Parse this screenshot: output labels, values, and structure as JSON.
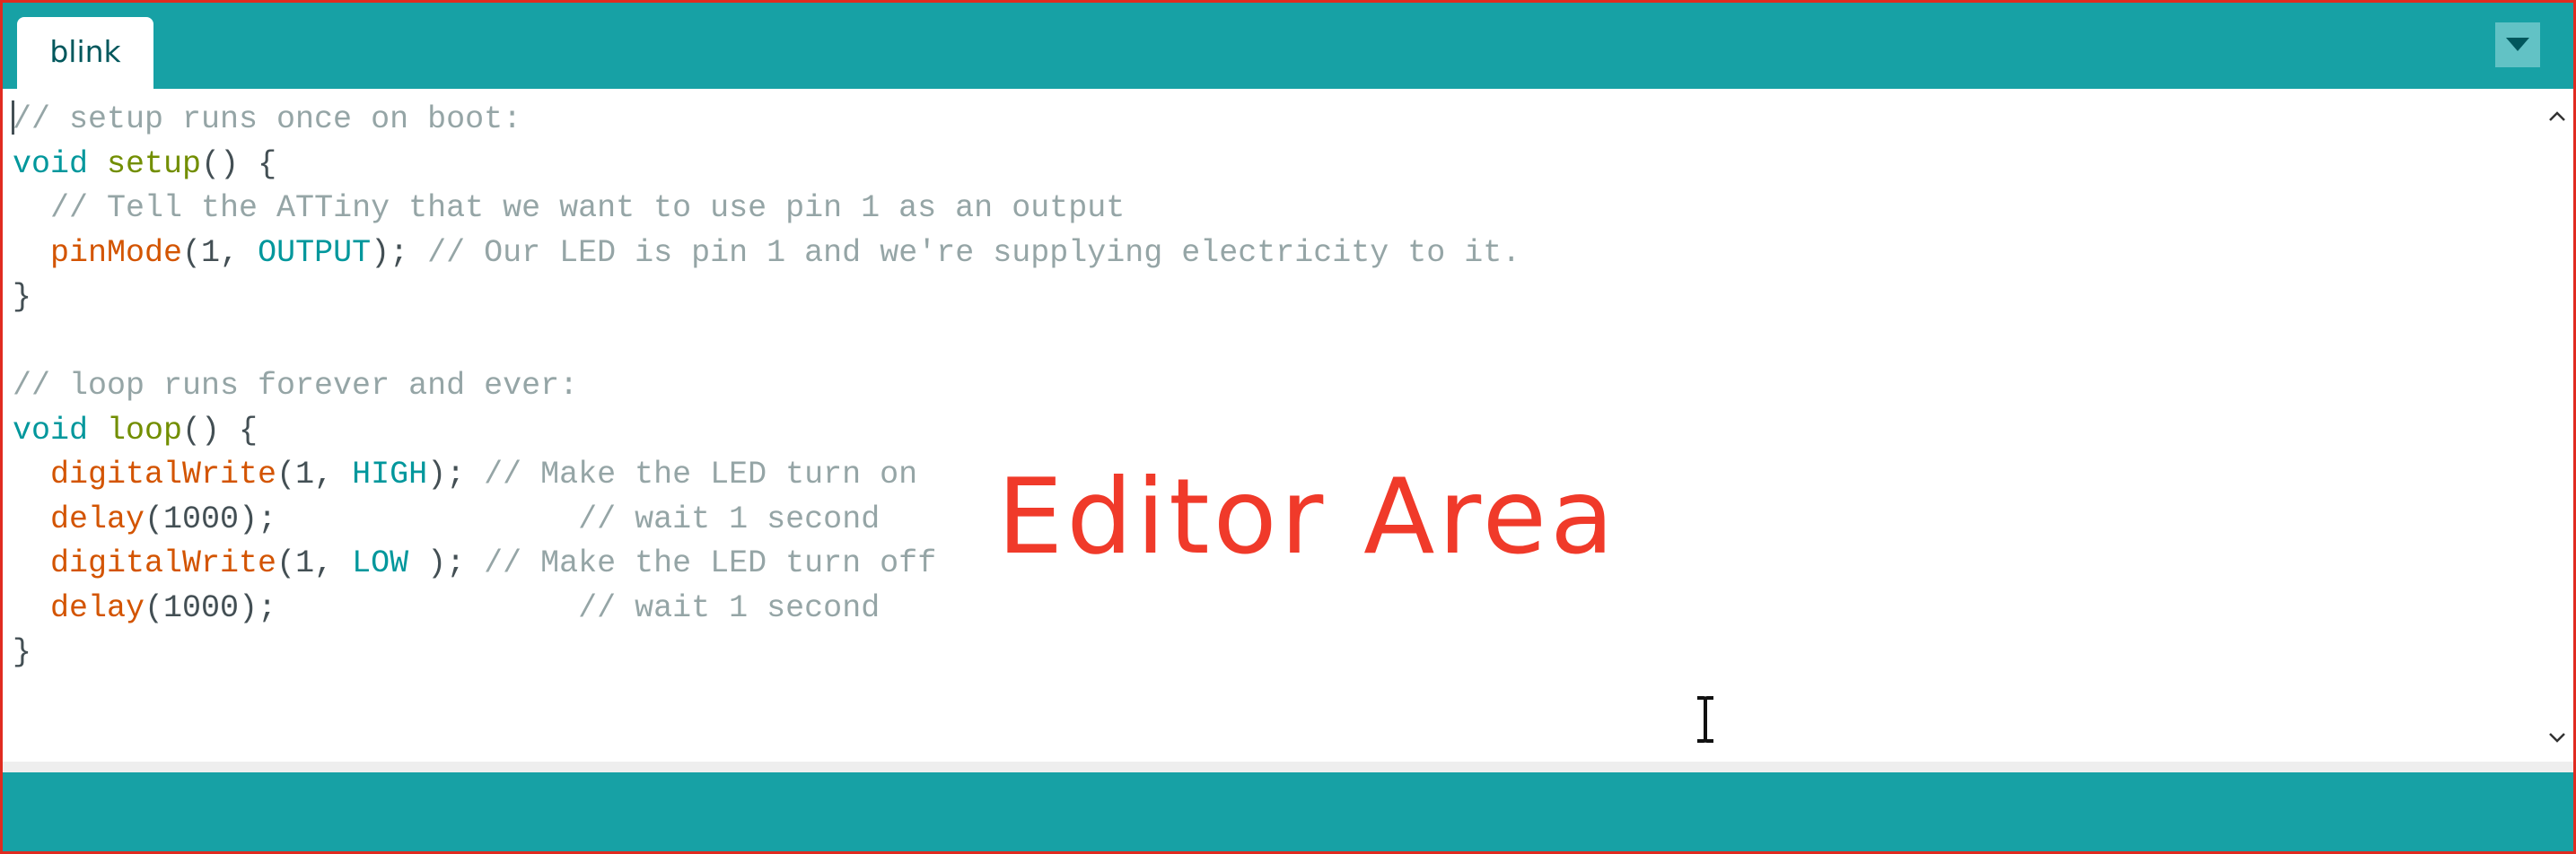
{
  "tabs": [
    {
      "label": "blink",
      "active": true
    }
  ],
  "tab_menu_icon": "triangle-down-icon",
  "overlay_label": "Editor Area",
  "colors": {
    "toolbar_teal": "#17a1a5",
    "tab_text": "#00575c",
    "comment": "#95a5a6",
    "keyword": "#00979c",
    "function": "#728e00",
    "builtin": "#d35400",
    "constant": "#00979c",
    "plain": "#434f54",
    "annotation_red": "#f03a2a"
  },
  "code_lines": [
    [
      [
        "comment",
        "// setup runs once on boot:"
      ]
    ],
    [
      [
        "keyword",
        "void"
      ],
      [
        "plain",
        " "
      ],
      [
        "function",
        "setup"
      ],
      [
        "plain",
        "() {"
      ]
    ],
    [
      [
        "plain",
        "  "
      ],
      [
        "comment",
        "// Tell the ATTiny that we want to use pin 1 as an output"
      ]
    ],
    [
      [
        "plain",
        "  "
      ],
      [
        "builtin",
        "pinMode"
      ],
      [
        "plain",
        "(1, "
      ],
      [
        "constant",
        "OUTPUT"
      ],
      [
        "plain",
        "); "
      ],
      [
        "comment",
        "// Our LED is pin 1 and we're supplying electricity to it."
      ]
    ],
    [
      [
        "plain",
        "}"
      ]
    ],
    [
      [
        "plain",
        ""
      ]
    ],
    [
      [
        "comment",
        "// loop runs forever and ever:"
      ]
    ],
    [
      [
        "keyword",
        "void"
      ],
      [
        "plain",
        " "
      ],
      [
        "function",
        "loop"
      ],
      [
        "plain",
        "() {"
      ]
    ],
    [
      [
        "plain",
        "  "
      ],
      [
        "builtin",
        "digitalWrite"
      ],
      [
        "plain",
        "(1, "
      ],
      [
        "constant",
        "HIGH"
      ],
      [
        "plain",
        "); "
      ],
      [
        "comment",
        "// Make the LED turn on"
      ]
    ],
    [
      [
        "plain",
        "  "
      ],
      [
        "builtin",
        "delay"
      ],
      [
        "plain",
        "(1000);                "
      ],
      [
        "comment",
        "// wait 1 second"
      ]
    ],
    [
      [
        "plain",
        "  "
      ],
      [
        "builtin",
        "digitalWrite"
      ],
      [
        "plain",
        "(1, "
      ],
      [
        "constant",
        "LOW"
      ],
      [
        "plain",
        " ); "
      ],
      [
        "comment",
        "// Make the LED turn off"
      ]
    ],
    [
      [
        "plain",
        "  "
      ],
      [
        "builtin",
        "delay"
      ],
      [
        "plain",
        "(1000);                "
      ],
      [
        "comment",
        "// wait 1 second"
      ]
    ],
    [
      [
        "plain",
        "}"
      ]
    ]
  ]
}
